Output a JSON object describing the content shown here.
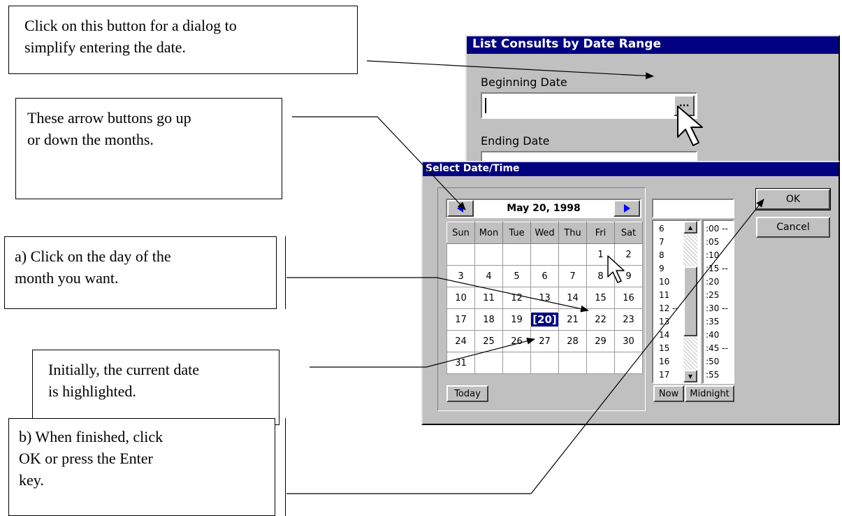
{
  "callouts": {
    "dialog_button": [
      "Click on this button for a dialog to",
      "simplify entering the date."
    ],
    "arrows": [
      "These arrow buttons go up",
      "or down the months."
    ],
    "click_day": [
      "a) Click on the day of the",
      "month you want."
    ],
    "current_date": [
      "Initially, the current date",
      "is highlighted."
    ],
    "finish": [
      "b) When finished, click",
      "OK or press the Enter",
      "key."
    ]
  },
  "list_window": {
    "title": "List Consults by Date Range",
    "beginning_label": "Beginning Date",
    "ellipsis_label": "...",
    "ending_label": "Ending Date"
  },
  "date_dialog": {
    "title": "Select Date/Time",
    "month_year": "May 20, 1998",
    "weekdays": [
      "Sun",
      "Mon",
      "Tue",
      "Wed",
      "Thu",
      "Fri",
      "Sat"
    ],
    "weeks": [
      [
        "",
        "",
        "",
        "",
        "",
        "1",
        "2"
      ],
      [
        "3",
        "4",
        "5",
        "6",
        "7",
        "8",
        "9"
      ],
      [
        "10",
        "11",
        "12",
        "13",
        "14",
        "15",
        "16"
      ],
      [
        "17",
        "18",
        "19",
        "20",
        "21",
        "22",
        "23"
      ],
      [
        "24",
        "25",
        "26",
        "27",
        "28",
        "29",
        "30"
      ],
      [
        "31",
        "",
        "",
        "",
        "",
        "",
        ""
      ]
    ],
    "selected_day": "20",
    "selected_display": "[20]",
    "hours": [
      "6",
      "7",
      "8",
      "9",
      "10",
      "11",
      "12 --",
      "13",
      "14",
      "15",
      "16",
      "17"
    ],
    "minutes": [
      ":00 --",
      ":05",
      ":10",
      ":15 --",
      ":20",
      ":25",
      ":30 --",
      ":35",
      ":40",
      ":45 --",
      ":50",
      ":55"
    ],
    "today_label": "Today",
    "now_label": "Now",
    "midnight_label": "Midnight",
    "ok_label": "OK",
    "cancel_label": "Cancel",
    "time_value": ""
  },
  "colors": {
    "titlebar": "#000080",
    "face": "#c0c0c0",
    "arrow": "#0000ff"
  }
}
